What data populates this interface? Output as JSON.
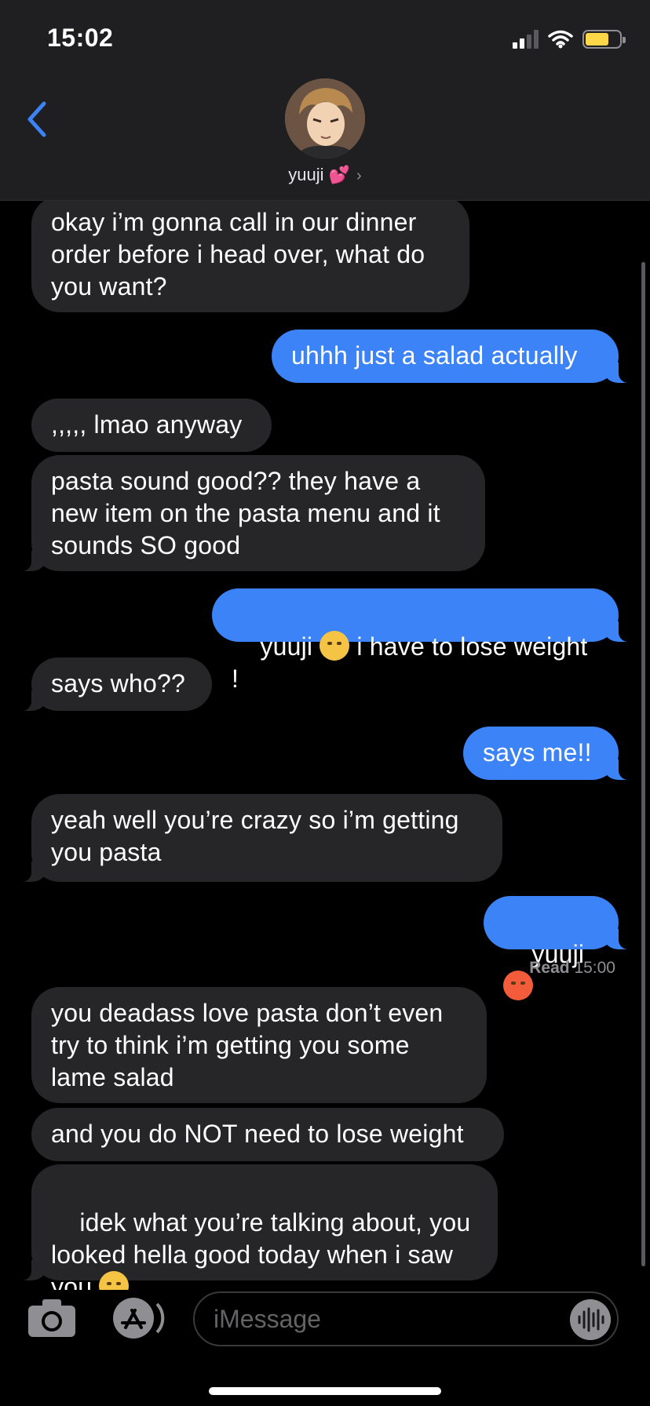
{
  "status_bar": {
    "time": "15:02"
  },
  "contact": {
    "name": "yuuji 💕",
    "chevron": "›"
  },
  "messages": [
    {
      "from": "them",
      "text": "okay i’m gonna call in our dinner\norder before i head over, what do\nyou want?"
    },
    {
      "from": "me",
      "text": "uhhh just a salad actually"
    },
    {
      "from": "them",
      "text": ",,,,, lmao anyway"
    },
    {
      "from": "them",
      "text": "pasta sound good?? they have a\nnew item on the pasta menu and it\nsounds SO good"
    },
    {
      "from": "me",
      "text_before": "yuuji ",
      "emoji": "weary-face-emoji",
      "text_after": " i have to lose weight !"
    },
    {
      "from": "them",
      "text": "says who??"
    },
    {
      "from": "me",
      "text": "says me!!"
    },
    {
      "from": "them",
      "text": "yeah well you’re crazy so i’m getting\nyou pasta"
    },
    {
      "from": "me",
      "text_before": "yuuji ",
      "emoji": "angry-face-emoji"
    },
    {
      "from": "them",
      "text": "you deadass love pasta don’t even\ntry to think i’m getting you some\nlame salad"
    },
    {
      "from": "them",
      "text": "and you do NOT need to lose weight"
    },
    {
      "from": "them",
      "text_before": "idek what you’re talking about, you\nlooked hella good today when i saw\nyou ",
      "emoji": "drooling-face-emoji"
    }
  ],
  "read_receipt": {
    "label": "Read",
    "time": "15:00"
  },
  "composer": {
    "placeholder": "iMessage"
  },
  "colors": {
    "outgoing_bubble": "#3b83f6",
    "incoming_bubble": "#262628",
    "accent": "#3b83f6"
  }
}
